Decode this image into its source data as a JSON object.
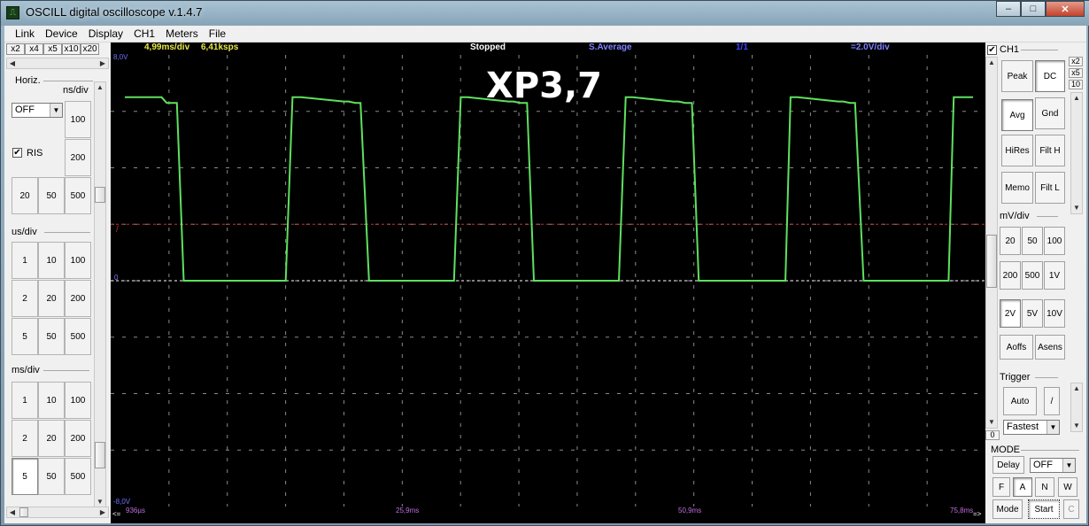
{
  "window": {
    "title": "OSCILL digital oscilloscope  v.1.4.7",
    "icon": "oscilloscope-app-icon",
    "minimize": "–",
    "maximize": "□",
    "close": "✕"
  },
  "menu": [
    "Link",
    "Device",
    "Display",
    "CH1",
    "Meters",
    "File"
  ],
  "left": {
    "zoom": [
      "x2",
      "x4",
      "x5",
      "x10",
      "x20"
    ],
    "horiz_label": "Horiz.",
    "ns_label": "ns/div",
    "trigger_combo": "OFF",
    "ris_label": "RIS",
    "ris_checked": "✔",
    "ns_buttons": [
      "100",
      "200",
      "20",
      "50",
      "500"
    ],
    "us_label": "us/div",
    "us_buttons": [
      "1",
      "10",
      "100",
      "2",
      "20",
      "200",
      "5",
      "50",
      "500"
    ],
    "ms_label": "ms/div",
    "ms_buttons": [
      "1",
      "10",
      "100",
      "2",
      "20",
      "200",
      "5",
      "50",
      "500"
    ],
    "ms_selected": "5"
  },
  "scope": {
    "status_timebase": "4,99ms/div",
    "status_rate": "6,41ksps",
    "status_state": "Stopped",
    "status_mode": "S.Average",
    "status_channel": "1/1",
    "status_volts": "=2.0V/div",
    "annotation": "XP3,7",
    "y_top_label": "8,0V",
    "y_bottom_label": "-8,0V",
    "zero_label": "0",
    "trigger_marker": "/",
    "left_arrow": "<=",
    "right_arrow": "=>",
    "x_ticks": [
      "936µs",
      "25,9ms",
      "50,9ms",
      "75,8ms"
    ],
    "colors": {
      "trace": "#5fe05f",
      "grid": "#8a8a8a",
      "trigger_level": "#c0302a",
      "zero_line": "#ffffff",
      "status_yellow": "#e8e84a",
      "status_white": "#ffffff",
      "status_blue": "#8080ff",
      "tick_label": "#c070e0"
    }
  },
  "chart_data": {
    "type": "line",
    "title": "XP3,7",
    "xlabel": "",
    "ylabel": "",
    "x_unit": "ms",
    "y_unit": "V",
    "ylim": [
      -8,
      8
    ],
    "xlim": [
      0.936,
      50.836
    ],
    "x_ticks": [
      "936µs",
      "25,9ms",
      "50,9ms",
      "75,8ms"
    ],
    "grid": true,
    "series": [
      {
        "values_x": [
          0.936,
          3.1,
          3.4,
          3.8,
          4.0,
          4.4,
          10.4,
          10.8,
          11.3,
          13.8,
          14.1,
          14.5,
          14.8,
          15.3,
          20.3,
          20.7,
          21.1,
          23.5,
          23.8,
          24.2,
          24.6,
          25.0,
          30.0,
          30.4,
          30.8,
          33.2,
          33.5,
          33.9,
          34.3,
          34.7,
          39.8,
          40.1,
          40.5,
          42.9,
          43.2,
          43.6,
          43.9,
          44.4,
          49.4,
          49.7,
          50.1,
          50.836
        ],
        "values_y": [
          6.5,
          6.5,
          6.3,
          6.3,
          6.3,
          0,
          0,
          6.5,
          6.5,
          6.35,
          6.35,
          6.3,
          6.3,
          0,
          0,
          6.5,
          6.5,
          6.35,
          6.35,
          6.3,
          6.3,
          0,
          0,
          6.5,
          6.5,
          6.35,
          6.35,
          6.3,
          6.3,
          0,
          0,
          6.5,
          6.5,
          6.35,
          6.35,
          6.3,
          6.3,
          0,
          0,
          6.5,
          6.5,
          6.5
        ]
      }
    ]
  },
  "right": {
    "ch_label": "CH1",
    "ch_checked": "✔",
    "x_small": [
      "x2",
      "x5",
      "10"
    ],
    "buttons_top": [
      "Peak",
      "DC",
      "Avg",
      "Gnd",
      "HiRes",
      "Filt H",
      "Memo",
      "Filt L"
    ],
    "mv_label": "mV/div",
    "mv_buttons": [
      "20",
      "50",
      "100",
      "200",
      "500",
      "1V"
    ],
    "v_buttons": [
      "2V",
      "5V",
      "10V"
    ],
    "aoffs": "Aoffs",
    "asens": "Asens",
    "trigger_label": "Trigger",
    "trig_auto": "Auto",
    "trig_slope": "/",
    "trig_speed": "Fastest",
    "zero_box": "0",
    "mode_label": "MODE",
    "delay_label": "Delay",
    "delay_value": "OFF",
    "mode_letters": [
      "F",
      "A",
      "N",
      "W"
    ],
    "mode_btn": "Mode",
    "start_btn": "Start",
    "c_btn": "C"
  }
}
